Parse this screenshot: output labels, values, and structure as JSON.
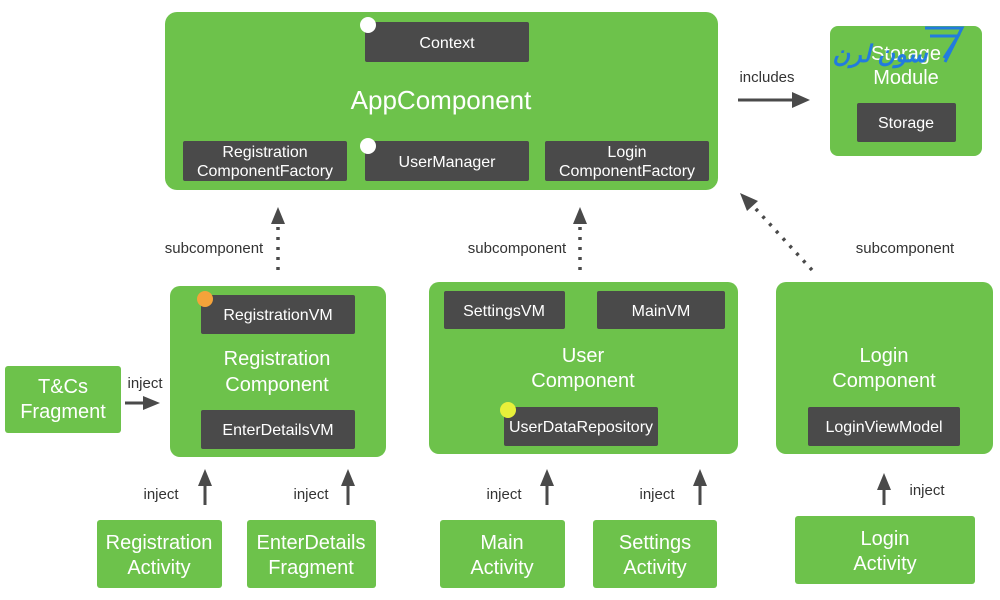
{
  "colors": {
    "component": "#6DC24B",
    "class_box": "#4A4A4A",
    "scope_singleton": "#FFFFFF",
    "scope_activity": "#F5A33A",
    "scope_user": "#E8F03A",
    "watermark": "#1E78E6"
  },
  "app_component": {
    "title": "AppComponent",
    "context": "Context",
    "registration_factory": [
      "Registration",
      "ComponentFactory"
    ],
    "user_manager": "UserManager",
    "login_factory": [
      "Login",
      "ComponentFactory"
    ]
  },
  "storage_module": {
    "title": [
      "Storage",
      "Module"
    ],
    "storage": "Storage"
  },
  "includes_label": "includes",
  "subcomponent_labels": [
    "subcomponent",
    "subcomponent",
    "subcomponent"
  ],
  "registration_component": {
    "title": [
      "Registration",
      "Component"
    ],
    "registration_vm": "RegistrationVM",
    "enter_details_vm": "EnterDetailsVM"
  },
  "user_component": {
    "title": [
      "User",
      "Component"
    ],
    "settings_vm": "SettingsVM",
    "main_vm": "MainVM",
    "user_data_repository": "UserDataRepository"
  },
  "login_component": {
    "title": [
      "Login",
      "Component"
    ],
    "login_view_model": "LoginViewModel"
  },
  "tcs_fragment": [
    "T&Cs",
    "Fragment"
  ],
  "inject_labels": [
    "inject",
    "inject",
    "inject",
    "inject",
    "inject",
    "inject"
  ],
  "bottom": {
    "registration_activity": [
      "Registration",
      "Activity"
    ],
    "enter_details_fragment": [
      "EnterDetails",
      "Fragment"
    ],
    "main_activity": [
      "Main",
      "Activity"
    ],
    "settings_activity": [
      "Settings",
      "Activity"
    ],
    "login_activity": [
      "Login",
      "Activity"
    ]
  },
  "watermark_text": "سون لرن"
}
